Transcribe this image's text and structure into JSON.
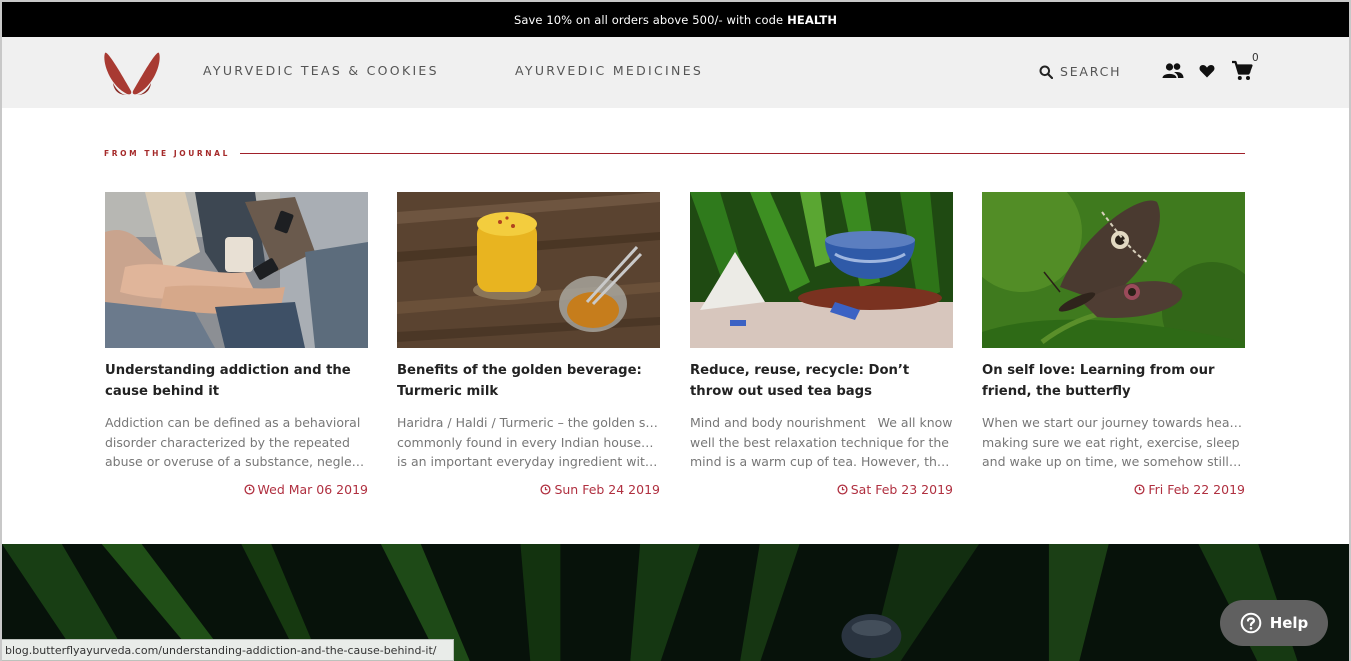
{
  "promo": {
    "text": "Save 10% on all orders above 500/- with code",
    "code": "HEALTH"
  },
  "header": {
    "logo_icon": "butterfly-logo",
    "brand_color": "#a83a32",
    "nav": [
      {
        "label": "AYURVEDIC TEAS & COOKIES"
      },
      {
        "label": "AYURVEDIC MEDICINES"
      }
    ],
    "search_label": "SEARCH",
    "cart_count": "0",
    "icons": [
      "search-icon",
      "users-icon",
      "heart-icon",
      "cart-icon"
    ]
  },
  "journal": {
    "label": "FROM THE JOURNAL",
    "accent": "#a0202a",
    "posts": [
      {
        "title": "Understanding addiction and the cause behind it",
        "excerpt": [
          "Addiction can be defined as a behavioral",
          "disorder characterized by the repeated",
          "abuse or overuse of a substance, neglecting…"
        ],
        "date": "Wed Mar 06 2019"
      },
      {
        "title": "Benefits of the golden beverage: Turmeric milk",
        "excerpt": [
          "Haridra / Haldi / Turmeric – the golden spice",
          "commonly found in every Indian household",
          "is an important everyday ingredient with…"
        ],
        "date": "Sun Feb 24 2019"
      },
      {
        "title": "Reduce, reuse, recycle: Don’t throw out used tea bags",
        "excerpt": [
          "Mind and body nourishment   We all know",
          "well the best relaxation technique for the",
          "mind is a warm cup of tea. However, the…"
        ],
        "date": "Sat Feb 23 2019"
      },
      {
        "title": "On self love: Learning from our friend, the butterfly",
        "excerpt": [
          "When we start our journey towards health,",
          "making sure we eat right, exercise, sleep",
          "and wake up on time, we somehow still fea…"
        ],
        "date": "Fri Feb 22 2019"
      }
    ]
  },
  "status_bar": {
    "url": "blog.butterflyayurveda.com/understanding-addiction-and-the-cause-behind-it/"
  },
  "help": {
    "label": "Help"
  }
}
